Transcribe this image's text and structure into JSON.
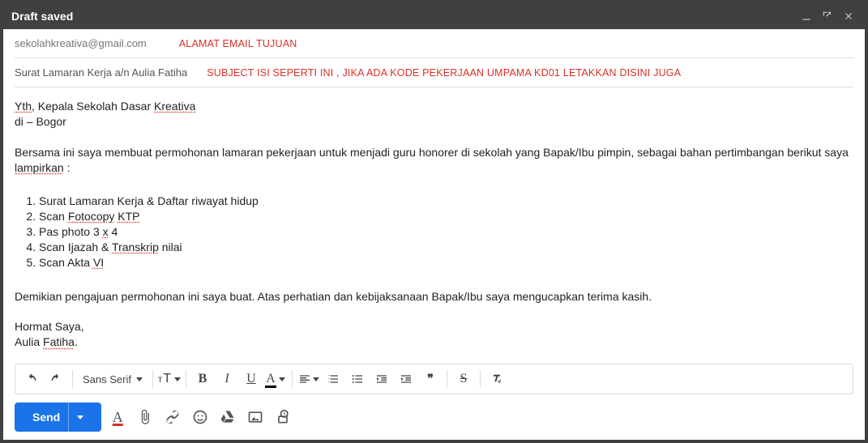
{
  "titlebar": {
    "title": "Draft saved"
  },
  "fields": {
    "to_value": "sekolahkreativa@gmail.com",
    "to_annot": "ALAMAT EMAIL TUJUAN",
    "subject_value": "Surat Lamaran Kerja a/n Aulia Fatiha",
    "subject_annot": "SUBJECT ISI SEPERTI INI , JIKA ADA KODE PEKERJAAN UMPAMA KD01 LETAKKAN DISINI JUGA"
  },
  "body": {
    "yth_pre": "Yth",
    "yth_mid": ", Kepala Sekolah Dasar ",
    "kreativa": "Kreativa",
    "line2": "di – Bogor",
    "para1_pre": "Bersama ini saya membuat permohonan lamaran pekerjaan untuk menjadi guru honorer di sekolah yang Bapak/Ibu pimpin, sebagai bahan pertimbangan berikut saya ",
    "lampirkan": "lampirkan",
    "para1_post": " :",
    "li1": "Surat Lamaran Kerja & Daftar riwayat hidup",
    "li2_pre": "Scan ",
    "fotocopy": "Fotocopy",
    "ktp": "KTP",
    "li3_pre": "Pas photo 3 ",
    "x": "x",
    "li3_post": " 4",
    "li4_pre": "Scan Ijazah & ",
    "transkrip": "Transkrip",
    "li4_post": " nilai",
    "li5_pre": "Scan Akta ",
    "vi": "VI",
    "closing": "Demikian pengajuan permohonan ini saya buat. Atas perhatian dan kebijaksanaan Bapak/Ibu saya mengucapkan terima kasih.",
    "hormat": "Hormat Saya,",
    "name_pre": "Aulia ",
    "fatiha": "Fatiha",
    "name_post": "."
  },
  "toolbar": {
    "font": "Sans Serif",
    "bold": "B",
    "italic": "I",
    "underline": "U",
    "textcolor": "A",
    "quote": "❞",
    "strike": "S"
  },
  "bottom": {
    "send": "Send",
    "a": "A"
  }
}
